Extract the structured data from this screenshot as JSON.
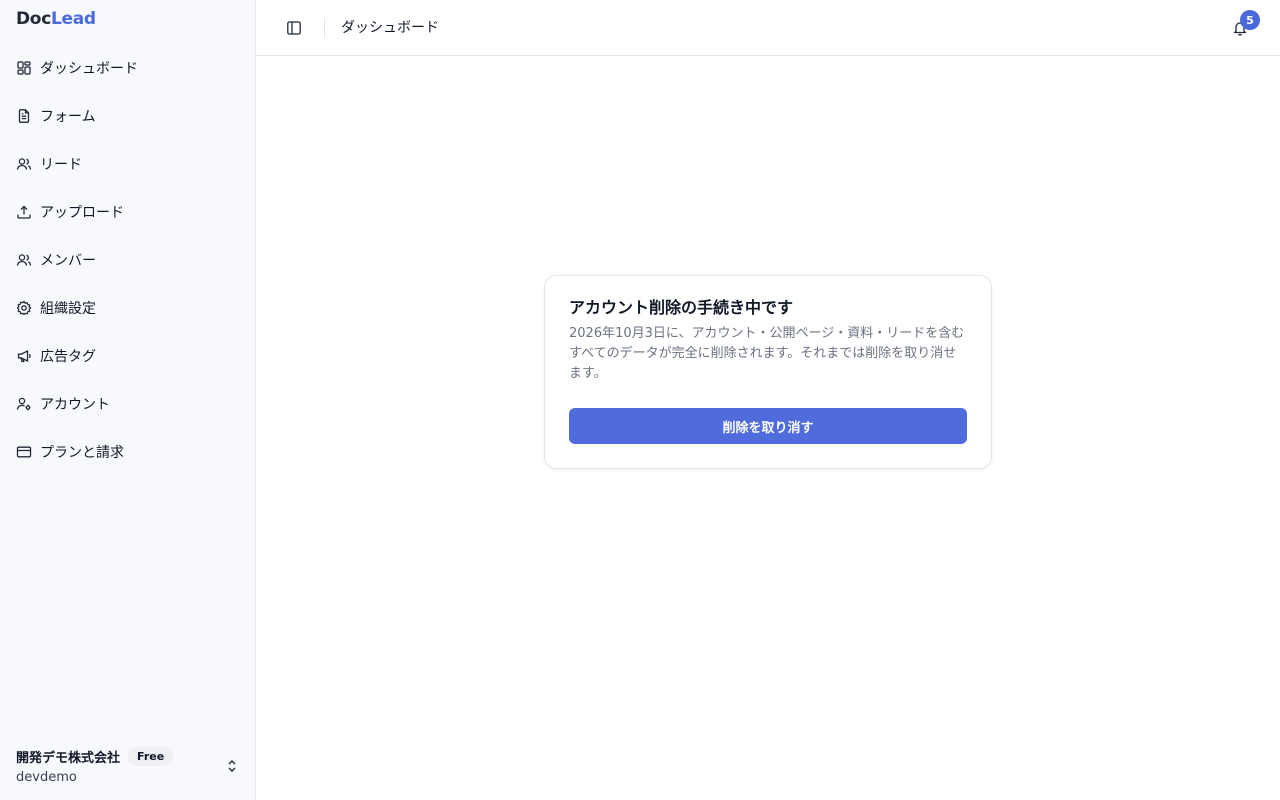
{
  "brand": {
    "part1": "Doc",
    "part2": "Lead"
  },
  "sidebar": {
    "items": [
      {
        "label": "ダッシュボード",
        "icon": "dashboard-icon"
      },
      {
        "label": "フォーム",
        "icon": "document-icon"
      },
      {
        "label": "リード",
        "icon": "users-icon"
      },
      {
        "label": "アップロード",
        "icon": "upload-icon"
      },
      {
        "label": "メンバー",
        "icon": "users-icon"
      },
      {
        "label": "組織設定",
        "icon": "gear-icon"
      },
      {
        "label": "広告タグ",
        "icon": "megaphone-icon"
      },
      {
        "label": "アカウント",
        "icon": "user-cog-icon"
      },
      {
        "label": "プランと請求",
        "icon": "credit-card-icon"
      }
    ],
    "org": {
      "name": "開発デモ株式会社",
      "plan": "Free",
      "slug": "devdemo"
    }
  },
  "header": {
    "title": "ダッシュボード",
    "notification_count": "5"
  },
  "card": {
    "title": "アカウント削除の手続き中です",
    "description": "2026年10月3日に、アカウント・公開ページ・資料・リードを含むすべてのデータが完全に削除されます。それまでは削除を取り消せます。",
    "button_label": "削除を取り消す"
  },
  "colors": {
    "accent": "#4f6bdc",
    "brand_accent": "#4a6ad9"
  }
}
